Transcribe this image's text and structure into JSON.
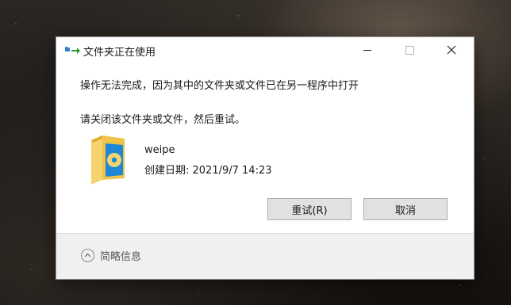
{
  "dialog": {
    "title": "文件夹正在使用",
    "message_line1": "操作无法完成，因为其中的文件夹或文件已在另一程序中打开",
    "message_line2": "请关闭该文件夹或文件，然后重试。",
    "file": {
      "name": "weipe",
      "created": "创建日期: 2021/9/7 14:23",
      "icon": "folder-icon"
    },
    "buttons": {
      "retry_label": "重试(R)",
      "cancel_label": "取消"
    },
    "footer": {
      "details_label": "简略信息"
    },
    "window_controls": {
      "minimize_icon": "minimize-icon",
      "maximize_icon": "maximize-icon",
      "close_icon": "close-icon"
    }
  },
  "colors": {
    "dialog_bg": "#ffffff",
    "footer_bg": "#f0f0f0",
    "button_bg": "#e1e1e1",
    "folder_yellow": "#f0c24a",
    "folder_blue_badge": "#1e88d6"
  }
}
